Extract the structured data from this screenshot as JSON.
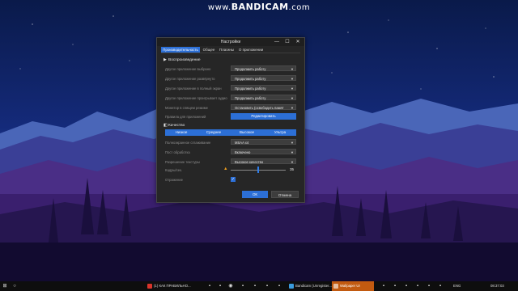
{
  "watermark": {
    "prefix": "www.",
    "brand": "BANDICAM",
    "suffix": ".com"
  },
  "window": {
    "title": "Настройки",
    "controls": {
      "minimize": "—",
      "maximize": "☐",
      "close": "✕"
    },
    "tabs": [
      {
        "label": "Производительность",
        "active": true
      },
      {
        "label": "Общее",
        "active": false
      },
      {
        "label": "Плагины",
        "active": false
      },
      {
        "label": "О приложении",
        "active": false
      }
    ],
    "playback": {
      "heading": "Воспроизведение",
      "rows": [
        {
          "label": "Другое приложение выбрано",
          "value": "Продолжить работу"
        },
        {
          "label": "Другое приложение развёрнуто",
          "value": "Продолжить работу"
        },
        {
          "label": "Другое приложение в полный экран",
          "value": "Продолжить работу"
        },
        {
          "label": "Другое приложение проигрывает аудио",
          "value": "Продолжить работу"
        },
        {
          "label": "Монитор в спящем режиме",
          "value": "Остановить (освободить памят"
        }
      ],
      "app_rules_label": "Правила для приложений",
      "app_rules_button": "Редактировать"
    },
    "quality": {
      "heading": "Качество",
      "levels": [
        "Низкое",
        "Среднее",
        "Высокое",
        "Ультра"
      ],
      "rows": [
        {
          "label": "Полноэкранное сглаживание",
          "value": "MSAA x4"
        },
        {
          "label": "Пост обработка",
          "value": "Включено"
        },
        {
          "label": "Разрешение текстуры",
          "value": "Высокое качество"
        }
      ],
      "framerate_label": "Кадры/сек.",
      "framerate_value": "35",
      "reflection_label": "Отражение",
      "reflection_checked": true
    },
    "ok_label": "ОК",
    "cancel_label": "Отмена"
  },
  "taskbar": {
    "apps": [
      {
        "label": "(1) КАК ПРАВИЛЬНО...",
        "color": "#d9342b",
        "active": false
      },
      {
        "label": "Bandicam (Unregister...",
        "color": "#3a9bdc",
        "active": false
      },
      {
        "label": "Wallpaper UI",
        "color": "#e06a1a",
        "active": true
      }
    ],
    "tray_text": "ENG",
    "clock": "08:37:03"
  },
  "colors": {
    "accent": "#2c6fd6",
    "window_bg": "#262626",
    "taskbar_active": "#c25a10"
  }
}
